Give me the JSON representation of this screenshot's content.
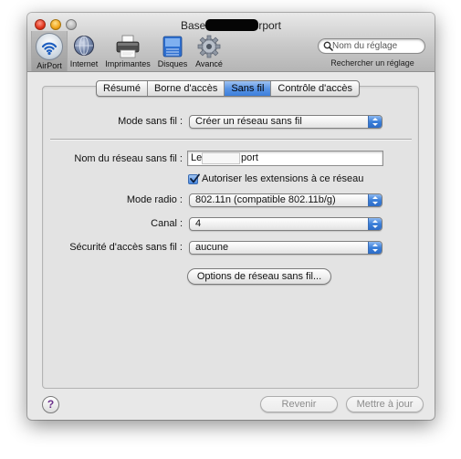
{
  "window": {
    "title_left": "Base",
    "title_right": "rport"
  },
  "toolbar": {
    "items": [
      {
        "label": "AirPort",
        "icon": "airport-icon"
      },
      {
        "label": "Internet",
        "icon": "globe-icon"
      },
      {
        "label": "Imprimantes",
        "icon": "printer-icon"
      },
      {
        "label": "Disques",
        "icon": "disk-icon"
      },
      {
        "label": "Avancé",
        "icon": "gear-icon"
      }
    ],
    "selected": "AirPort"
  },
  "search": {
    "placeholder": "Nom du réglage",
    "hint": "Rechercher un réglage"
  },
  "tabs": [
    {
      "label": "Résumé"
    },
    {
      "label": "Borne d'accès"
    },
    {
      "label": "Sans fil",
      "active": true
    },
    {
      "label": "Contrôle d'accès"
    }
  ],
  "form": {
    "mode_label": "Mode sans fil :",
    "mode_value": "Créer un réseau sans fil",
    "network_name_label": "Nom du réseau sans fil :",
    "network_name_prefix": "Le",
    "network_name_suffix": "port",
    "extensions_label": "Autoriser les extensions à ce réseau",
    "extensions_checked": true,
    "radio_label": "Mode radio :",
    "radio_value": "802.11n (compatible 802.11b/g)",
    "channel_label": "Canal :",
    "channel_value": "4",
    "security_label": "Sécurité d'accès sans fil :",
    "security_value": "aucune",
    "options_button": "Options de réseau sans fil..."
  },
  "footer": {
    "help": "?",
    "revert_button": "Revenir",
    "update_button": "Mettre à jour"
  },
  "colors": {
    "accent": "#3d7fdb",
    "help_glyph": "#6b2f8a"
  }
}
